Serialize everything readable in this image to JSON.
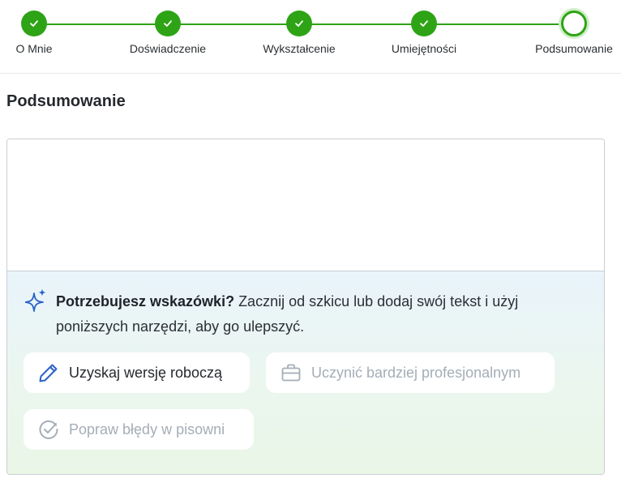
{
  "stepper": {
    "steps": [
      {
        "label": "O Mnie",
        "status": "done"
      },
      {
        "label": "Doświadczenie",
        "status": "done"
      },
      {
        "label": "Wykształcenie",
        "status": "done"
      },
      {
        "label": "Umiejętności",
        "status": "done"
      },
      {
        "label": "Podsumowanie",
        "status": "current"
      }
    ],
    "accent_color": "#2ea316"
  },
  "section": {
    "title": "Podsumowanie"
  },
  "editor": {
    "value": "",
    "placeholder": ""
  },
  "assistant": {
    "icon": "sparkle-icon",
    "hint_bold": "Potrzebujesz wskazówki?",
    "hint_text": " Zacznij od szkicu lub dodaj swój tekst i użyj poniższych narzędzi, aby go ulepszyć.",
    "buttons": [
      {
        "label": "Uzyskaj wersję roboczą",
        "icon": "pencil-icon",
        "enabled": true
      },
      {
        "label": "Uczynić bardziej profesjonalnym",
        "icon": "briefcase-icon",
        "enabled": false
      },
      {
        "label": "Popraw błędy w pisowni",
        "icon": "check-circle-icon",
        "enabled": false
      }
    ]
  }
}
